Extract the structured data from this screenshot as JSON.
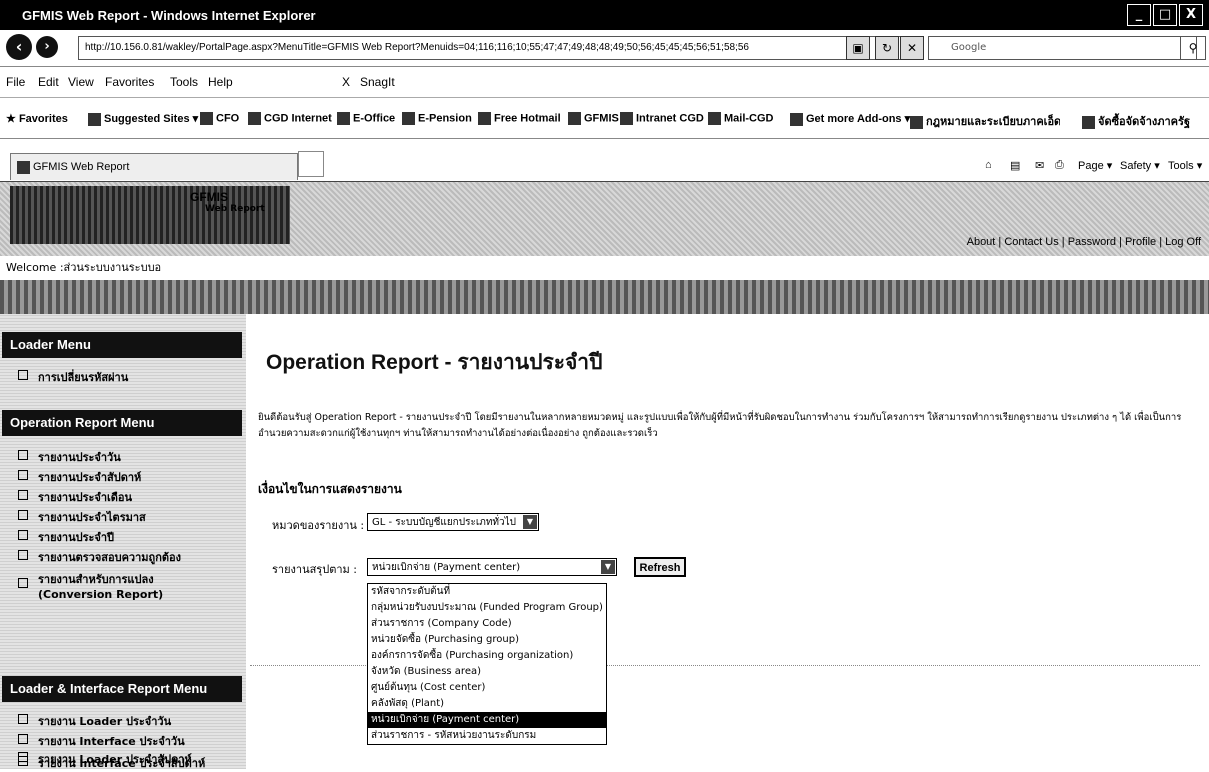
{
  "window": {
    "title": "GFMIS Web Report - Windows Internet Explorer",
    "min": "_",
    "max": "□",
    "close": "X"
  },
  "address": {
    "url": "http://10.156.0.81/wakley/PortalPage.aspx?MenuTitle=GFMIS Web Report?Menuids=04;116;116;10;55;47;47;49;48;48;49;50;56;45;45;45;56;51;58;56",
    "search_placeholder": "Google"
  },
  "menubar": {
    "items": [
      "File",
      "Edit",
      "View",
      "Favorites",
      "Tools",
      "Help"
    ],
    "close_x": "X",
    "snagit": "SnagIt"
  },
  "favorites": {
    "label": "Favorites",
    "items": [
      "Suggested Sites ▾",
      "CFO",
      "CGD Internet",
      "E-Office",
      "E-Pension",
      "Free Hotmail",
      "GFMIS",
      "Intranet CGD",
      "Mail-CGD",
      "Get more Add-ons ▾",
      "กฎหมายและระเบียบภาคเอ็ดC...",
      "จัดซื้อจัดจ้างภาครัฐ"
    ]
  },
  "tab": {
    "label": "GFMIS Web Report"
  },
  "tools": {
    "page": "Page ▾",
    "safety": "Safety ▾",
    "tools": "Tools ▾"
  },
  "header": {
    "logo_text": "GFMIS",
    "logo_sub": "Web Report",
    "links": "About | Contact Us | Password | Profile | Log Off"
  },
  "welcome": "Welcome :ส่วนระบบงานระบบอ",
  "sidebar": {
    "loader_menu": {
      "title": "Loader Menu",
      "items": [
        "การเปลี่ยนรหัสผ่าน"
      ]
    },
    "operation_menu": {
      "title": "Operation Report Menu",
      "items": [
        "รายงานประจำวัน",
        "รายงานประจำสัปดาห์",
        "รายงานประจำเดือน",
        "รายงานประจำไตรมาส",
        "รายงานประจำปี",
        "รายงานตรวจสอบความถูกต้อง",
        "รายงานสำหรับการแปลง (Conversion Report)"
      ]
    },
    "interface_menu": {
      "title": "Loader & Interface Report Menu",
      "items": [
        "รายงาน Loader ประจำวัน",
        "รายงาน Interface ประจำวัน",
        "รายงาน Loader ประจำสัปดาห์",
        "รายงาน Interface ประจำสัปดาห์"
      ]
    }
  },
  "content": {
    "title": "Operation Report - รายงานประจำปี",
    "description": "ยินดีต้อนรับสู่ Operation Report - รายงานประจำปี โดยมีรายงานในหลากหลายหมวดหมู่ และรูปแบบเพื่อให้กับผู้ที่มีหน้าที่รับผิดชอบในการทำงาน ร่วมกับโครงการฯ ให้สามารถทำการเรียกดูรายงาน ประเภทต่าง ๆ ได้ เพื่อเป็นการอำนวยความสะดวกแก่ผู้ใช้งานทุกฯ ท่านให้สามารถทำงานได้อย่างต่อเนื่องอย่าง ถูกต้องและรวดเร็ว",
    "conditions_heading": "เงื่อนไขในการแสดงรายงาน",
    "category_label": "หมวดของรายงาน :",
    "category_value": "GL - ระบบบัญชีแยกประเภททั่วไป",
    "summary_label": "รายงานสรุปตาม :",
    "summary_value": "หน่วยเบิกจ่าย (Payment center)",
    "refresh": "Refresh",
    "options": [
      "รหัสจากระดับต้นที่",
      "กลุ่มหน่วยรับงบประมาณ (Funded Program Group)",
      "ส่วนราชการ (Company Code)",
      "หน่วยจัดซื้อ (Purchasing group)",
      "องค์กรการจัดซื้อ (Purchasing organization)",
      "จังหวัด (Business area)",
      "ศูนย์ต้นทุน (Cost center)",
      "คลังพัสดุ (Plant)",
      "หน่วยเบิกจ่าย (Payment center)",
      "ส่วนราชการ - รหัสหน่วยงานระดับกรม"
    ],
    "selected_option_index": 8
  },
  "colors": {
    "titlebar": "#000000",
    "menuhead": "#111111",
    "selected": "#000000"
  }
}
